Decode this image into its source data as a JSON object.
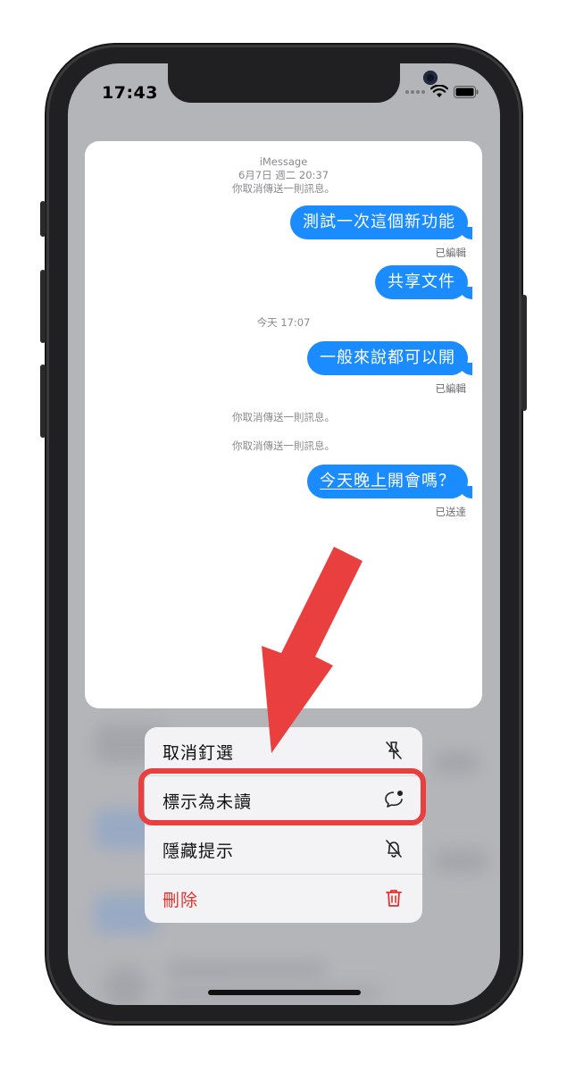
{
  "status_bar": {
    "time": "17:43"
  },
  "conversation": {
    "service": "iMessage",
    "first_date": "6月7日 週二 20:37",
    "unsent_notice": "你取消傳送一則訊息。",
    "today_time": "今天 17:07",
    "messages": [
      {
        "text": "測試一次這個新功能",
        "status": "已編輯"
      },
      {
        "text": "共享文件",
        "status": ""
      },
      {
        "text": "一般來說都可以開",
        "status": "已編輯"
      },
      {
        "text_underlined": "今天晚上",
        "text_rest": "開會嗎？",
        "status": "已送達"
      }
    ]
  },
  "menu": {
    "items": [
      {
        "label": "取消釘選",
        "icon": "unpin-icon"
      },
      {
        "label": "標示為未讀",
        "icon": "mark-unread-icon"
      },
      {
        "label": "隱藏提示",
        "icon": "bell-slash-icon"
      },
      {
        "label": "刪除",
        "icon": "trash-icon"
      }
    ]
  },
  "colors": {
    "bubble_blue": "#1a8cff",
    "annotation_red": "#ea3f3f",
    "delete_red": "#e5322d"
  }
}
